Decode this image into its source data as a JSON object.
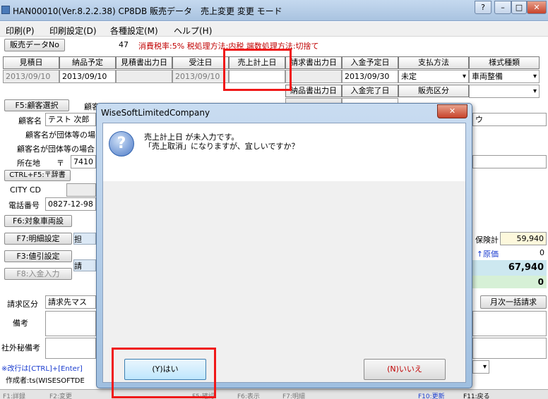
{
  "window": {
    "title": "HAN00010(Ver.8.2.2.38) CP8DB 販売データ　売上変更 変更 モード",
    "help_btn": "?",
    "min_btn": "–",
    "max_btn": "□",
    "close_btn": "✕"
  },
  "menu": [
    "印刷(P)",
    "印刷設定(D)",
    "各種設定(M)",
    "ヘルプ(H)"
  ],
  "toolbar": {
    "sales_no_btn": "販売データNo",
    "sales_no": "47",
    "tax_info": "消費税率:5%  税処理方法:内税  端数処理方法:切捨て"
  },
  "dates": {
    "headers": [
      "見積日",
      "納品予定",
      "見積書出力日",
      "受注日",
      "売上計上日",
      "請求書出力日",
      "入金予定日",
      "支払方法",
      "様式種類"
    ],
    "values": [
      "2013/09/10",
      "2013/09/10",
      "",
      "2013/09/10",
      "",
      "",
      "2013/09/30",
      "未定",
      "車両整備"
    ],
    "headers2": [
      "納品書出力日",
      "入金完了日",
      "販売区分"
    ],
    "values2": [
      "",
      ""
    ]
  },
  "customer": {
    "select_btn": "F5:顧客選択",
    "code_label": "顧客",
    "name_label": "顧客名",
    "name_value": "テスト 次郎",
    "group_label1": "顧客名が団体等の場",
    "group_label2": "顧客名が団体等の場合",
    "address_label": "所在地",
    "postal_mark": "〒",
    "postal_value": "7410",
    "dict_btn": "CTRL+F5:〒辞書",
    "city_label": "CITY CD",
    "phone_label": "電話番号",
    "phone_value": "0827-12-98",
    "right_partial": "ウ"
  },
  "functions": {
    "vehicle": "F6:対象車両設",
    "detail": "F7:明細設定",
    "discount": "F3:値引設定",
    "payment": "F8:入金入力",
    "partial1": "担",
    "partial2": "請"
  },
  "totals": {
    "insurance_label": "保険計",
    "insurance_value": "59,940",
    "cost_label": "↑原価",
    "cost_value": "0",
    "total_value": "67,940",
    "zero_value": "0"
  },
  "billing": {
    "label": "請求区分",
    "value": "請求先マス",
    "right_label": "月次一括請求"
  },
  "notes": {
    "remarks_label": "備考",
    "internal_label": "社外秘備考",
    "newline_hint": "※改行は[CTRL]+[Enter]",
    "creator": "作成者:ts(WISESOFTDE"
  },
  "dialog": {
    "title": "WiseSoftLimitedCompany",
    "close": "✕",
    "icon": "question-icon",
    "icon_glyph": "?",
    "line1": "売上計上日 が未入力です。",
    "line2": "「売上取消」になりますが、宜しいですか？",
    "yes": "(Y)はい",
    "no": "(N)いいえ"
  },
  "bottom_keys": [
    "F1:詳録",
    "F2:変更",
    "F3:",
    "F4:",
    "F5:確認",
    "F6:表示",
    "F7:明細",
    "F8:",
    "F9:",
    "F10:更新",
    "F11:戻る",
    "F12:"
  ]
}
